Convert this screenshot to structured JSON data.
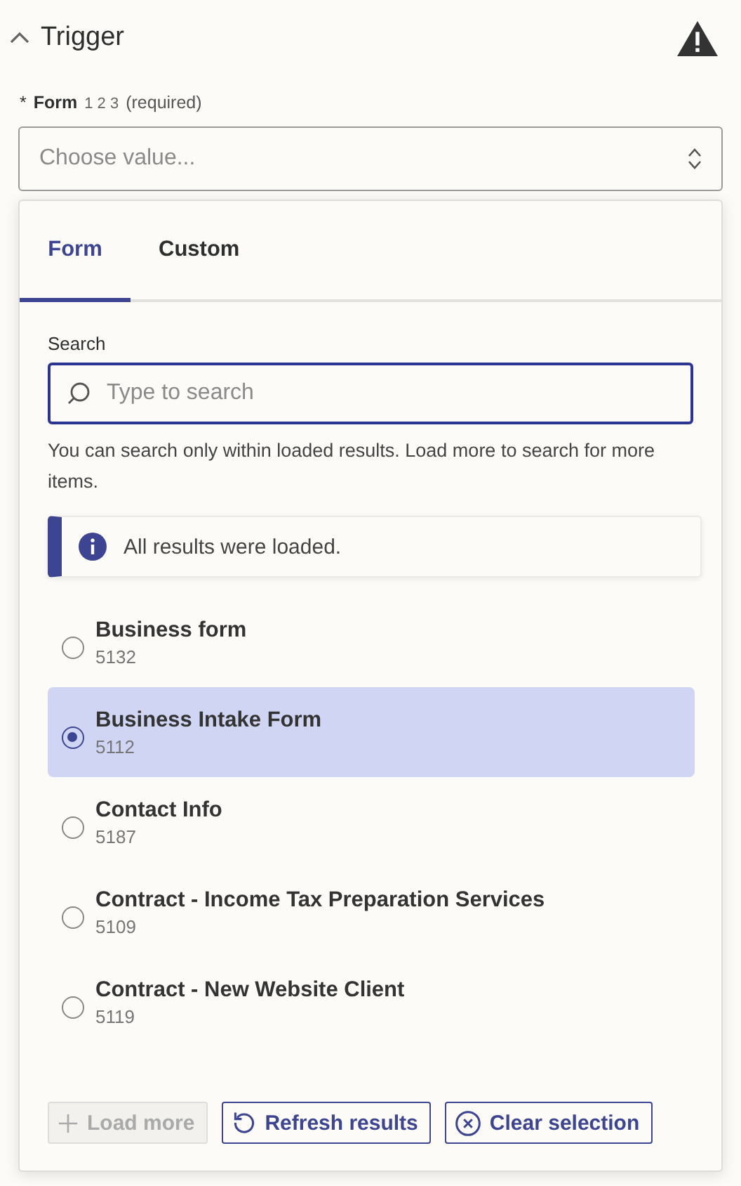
{
  "section": {
    "title": "Trigger",
    "expanded": true,
    "warning": true
  },
  "field": {
    "required_mark": "*",
    "label": "Form",
    "type_hint": "1 2 3",
    "required_note": "(required)",
    "placeholder": "Choose value..."
  },
  "tabs": [
    {
      "label": "Form",
      "selected": true
    },
    {
      "label": "Custom",
      "selected": false
    }
  ],
  "search": {
    "label": "Search",
    "placeholder": "Type to search",
    "help": "You can search only within loaded results. Load more to search for more items."
  },
  "notice": {
    "text": "All results were loaded."
  },
  "options": [
    {
      "name": "Business form",
      "id": "5132",
      "selected": false
    },
    {
      "name": "Business Intake Form",
      "id": "5112",
      "selected": true
    },
    {
      "name": "Contact Info",
      "id": "5187",
      "selected": false
    },
    {
      "name": "Contract - Income Tax Preparation Services",
      "id": "5109",
      "selected": false
    },
    {
      "name": "Contract - New Website Client",
      "id": "5119",
      "selected": false
    }
  ],
  "buttons": [
    {
      "label": "Load more",
      "kind": "load",
      "disabled": true
    },
    {
      "label": "Refresh results",
      "kind": "refresh",
      "disabled": false
    },
    {
      "label": "Clear selection",
      "kind": "clear",
      "disabled": false
    }
  ]
}
